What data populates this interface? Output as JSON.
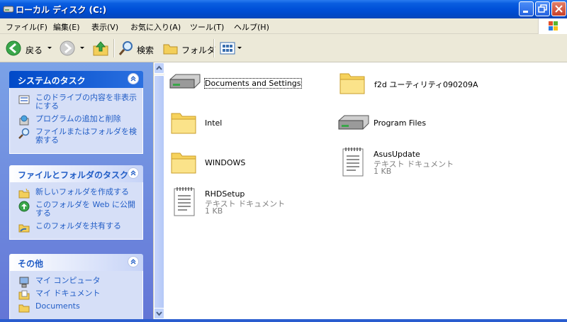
{
  "window": {
    "title": "ローカル ディスク (C:)"
  },
  "menu": [
    "ファイル(F)",
    "編集(E)",
    "表示(V)",
    "お気に入り(A)",
    "ツール(T)",
    "ヘルプ(H)"
  ],
  "toolbar": {
    "back_label": "戻る",
    "search_label": "検索",
    "folders_label": "フォルダ"
  },
  "sidebar": {
    "system_tasks": {
      "title": "システムのタスク",
      "items": [
        "このドライブの内容を非表示にする",
        "プログラムの追加と削除",
        "ファイルまたはフォルダを検索する"
      ]
    },
    "file_tasks": {
      "title": "ファイルとフォルダのタスク",
      "items": [
        "新しいフォルダを作成する",
        "このフォルダを Web に公開する",
        "このフォルダを共有する"
      ]
    },
    "other": {
      "title": "その他",
      "items": [
        "マイ コンピュータ",
        "マイ ドキュメント",
        "Documents"
      ]
    }
  },
  "files": [
    {
      "name": "Documents and Settings",
      "icon": "drive-folder-icon"
    },
    {
      "name": "f2d ユーティリティ090209A",
      "icon": "folder-icon"
    },
    {
      "name": "Intel",
      "icon": "folder-icon"
    },
    {
      "name": "Program Files",
      "icon": "drive-folder-icon"
    },
    {
      "name": "WINDOWS",
      "icon": "folder-icon"
    },
    {
      "name": "AsusUpdate",
      "type": "テキスト ドキュメント",
      "size": "1 KB",
      "icon": "text-document-icon"
    },
    {
      "name": "RHDSetup",
      "type": "テキスト ドキュメント",
      "size": "1 KB",
      "icon": "text-document-icon"
    }
  ],
  "colors": {
    "titlebar": "#0050d8",
    "sidebar_bg": "#7ba2e7",
    "link": "#215dc6"
  }
}
